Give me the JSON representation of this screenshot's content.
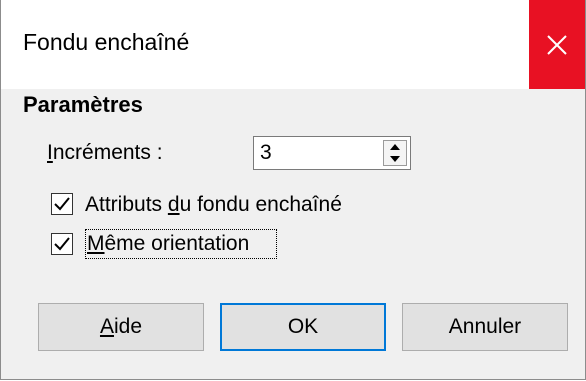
{
  "window": {
    "title": "Fondu enchaîné",
    "close_icon": "close-icon",
    "close_color": "#e81123",
    "accent": "#0078d7"
  },
  "params": {
    "section_title": "Paramètres",
    "increments": {
      "label_underlined": "I",
      "label_rest": "ncréments :",
      "value": "3"
    },
    "attributes": {
      "checked": true,
      "label_before": "Attributs ",
      "label_underlined": "d",
      "label_after": "u fondu enchaîné"
    },
    "same_orientation": {
      "checked": true,
      "label_underlined": "M",
      "label_rest": "ême orientation"
    }
  },
  "buttons": {
    "help": {
      "underlined": "A",
      "rest": "ide"
    },
    "ok": "OK",
    "cancel": "Annuler"
  }
}
